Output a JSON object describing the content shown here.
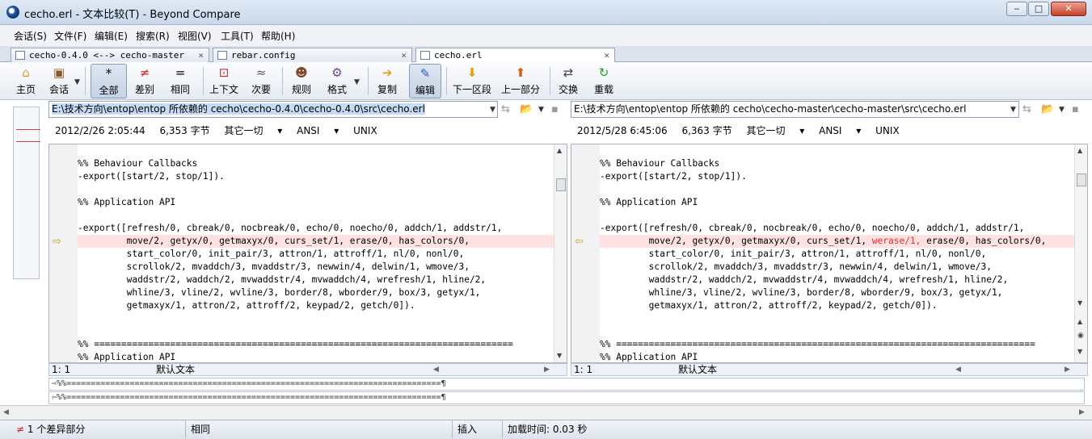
{
  "window": {
    "title": "cecho.erl - 文本比较(T) - Beyond Compare",
    "min": "‒",
    "max": "□",
    "close": "✕"
  },
  "menu": [
    "会话(S)",
    "文件(F)",
    "编辑(E)",
    "搜索(R)",
    "视图(V)",
    "工具(T)",
    "帮助(H)"
  ],
  "tabs": [
    {
      "label": "cecho-0.4.0 <--> cecho-master"
    },
    {
      "label": "rebar.config"
    },
    {
      "label": "cecho.erl"
    }
  ],
  "tab_close": "×",
  "toolbar": {
    "home": "主页",
    "session": "会话",
    "all": "全部",
    "diffs": "差别",
    "same": "相同",
    "context": "上下文",
    "minor": "次要",
    "rules": "规则",
    "format": "格式",
    "copy": "复制",
    "edit": "编辑",
    "next": "下一区段",
    "prev": "上一部分",
    "swap": "交换",
    "reload": "重载"
  },
  "left": {
    "path": "E:\\技术方向\\entop\\entop 所依赖的 cecho\\cecho-0.4.0\\cecho-0.4.0\\src\\cecho.erl",
    "date": "2012/2/26 2:05:44",
    "size": "6,353 字节",
    "filter": "其它一切",
    "encoding": "ANSI",
    "lineend": "UNIX",
    "pos": "1: 1",
    "mode": "默认文本",
    "lines": [
      "%% Behaviour Callbacks",
      "-export([start/2, stop/1]).",
      "",
      "%% Application API",
      "",
      "-export([refresh/0, cbreak/0, nocbreak/0, echo/0, noecho/0, addch/1, addstr/1,",
      "         move/2, getyx/0, getmaxyx/0, curs_set/1, erase/0, has_colors/0,",
      "         start_color/0, init_pair/3, attron/1, attroff/1, nl/0, nonl/0,",
      "         scrollok/2, mvaddch/3, mvaddstr/3, newwin/4, delwin/1, wmove/3,",
      "         waddstr/2, waddch/2, mvwaddstr/4, mvwaddch/4, wrefresh/1, hline/2,",
      "         whline/3, vline/2, wvline/3, border/8, wborder/9, box/3, getyx/1,",
      "         getmaxyx/1, attron/2, attroff/2, keypad/2, getch/0]).",
      "",
      "",
      "%% =============================================================================",
      "%% Application API",
      "%% ============================================================================="
    ]
  },
  "right": {
    "path": "E:\\技术方向\\entop\\entop 所依赖的 cecho\\cecho-master\\cecho-master\\src\\cecho.erl",
    "date": "2012/5/28 6:45:06",
    "size": "6,363 字节",
    "filter": "其它一切",
    "encoding": "ANSI",
    "lineend": "UNIX",
    "pos": "1: 1",
    "mode": "默认文本",
    "lines": [
      "%% Behaviour Callbacks",
      "-export([start/2, stop/1]).",
      "",
      "%% Application API",
      "",
      "-export([refresh/0, cbreak/0, nocbreak/0, echo/0, noecho/0, addch/1, addstr/1,",
      "         move/2, getyx/0, getmaxyx/0, curs_set/1, ",
      "         start_color/0, init_pair/3, attron/1, attroff/1, nl/0, nonl/0,",
      "         scrollok/2, mvaddch/3, mvaddstr/3, newwin/4, delwin/1, wmove/3,",
      "         waddstr/2, waddch/2, mvwaddstr/4, mvwaddch/4, wrefresh/1, hline/2,",
      "         whline/3, vline/2, wvline/3, border/8, wborder/9, box/3, getyx/1,",
      "         getmaxyx/1, attron/2, attroff/2, keypad/2, getch/0]).",
      "",
      "",
      "%% =============================================================================",
      "%% Application API",
      "%% ============================================================================="
    ],
    "diff_inserted": "werase/1,",
    "diff_tail": " erase/0, has_colors/0,"
  },
  "diffbar": {
    "top": "%%=============================================================================¶",
    "bottom": "%%=============================================================================¶"
  },
  "status": {
    "diffs": "1 个差异部分",
    "same": "相同",
    "insert": "插入",
    "load": "加载时间: 0.03 秒"
  },
  "colors": {
    "diff_bg": "#ffe1e1",
    "diff_text": "#e0302a",
    "accent": "#2a60b0"
  }
}
